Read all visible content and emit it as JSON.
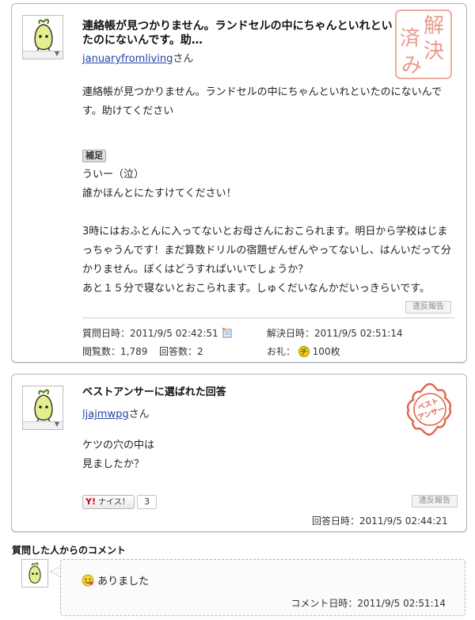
{
  "question": {
    "title": "連絡帳が見つかりません。ランドセルの中にちゃんといれといたのにないんです。助…",
    "username": "januaryfromliving",
    "honorific": "さん",
    "resolved_stamp": "解決済み",
    "paragraphs": [
      "連絡帳が見つかりません。ランドセルの中にちゃんといれといたのにないんです。助けてください"
    ],
    "supplement_label": "補足",
    "supplement_lines": [
      "ういー（泣）",
      "誰かほんとにたすけてください！",
      "",
      "3時にはおふとんに入ってないとお母さんにおこられます。明日から学校はじまっちゃうんです！まだ算数ドリルの宿題ぜんぜんやってないし、はんいだって分かりません。ぼくはどうすればいいでしょうか？",
      "あと１５分で寝ないとおこられます。しゅくだいなんかだいっきらいです。"
    ],
    "report_label": "違反報告",
    "asked_label": "質問日時：",
    "asked_value": "2011/9/5 02:42:51",
    "resolved_label": "解決日時：",
    "resolved_value": "2011/9/5 02:51:14",
    "views_label": "閲覧数：",
    "views_value": "1,789",
    "answers_label": "回答数：",
    "answers_value": "2",
    "reward_label": "お礼：",
    "reward_value": "100枚"
  },
  "best_answer": {
    "heading": "ベストアンサーに選ばれた回答",
    "username": "ljajmwpg",
    "honorific": "さん",
    "stamp_text": "ベストアンサー",
    "lines": [
      "ケツの穴の中は",
      "見ましたか？"
    ],
    "nice_label": "ナイス！",
    "nice_count": "3",
    "report_label": "違反報告",
    "answered_label": "回答日時：",
    "answered_value": "2011/9/5 02:44:21"
  },
  "comment": {
    "section_title": "質問した人からのコメント",
    "text": "ありました",
    "time_label": "コメント日時：",
    "time_value": "2011/9/5 02:51:14"
  },
  "colors": {
    "link": "#2545a4",
    "stamp_red": "#e0634b",
    "border": "#b4b4b4"
  }
}
